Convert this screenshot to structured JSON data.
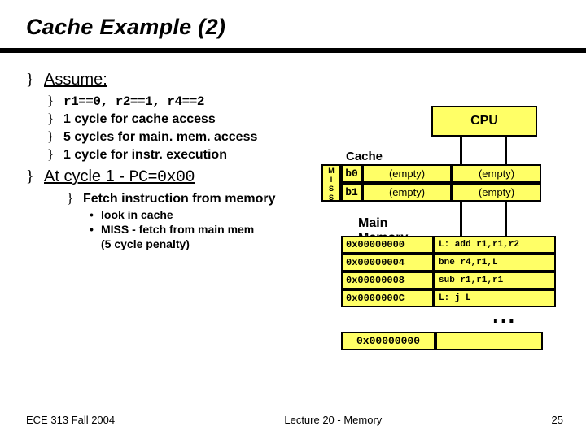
{
  "title": "Cache Example (2)",
  "assume": {
    "heading": "Assume:",
    "items": [
      "r1==0, r2==1, r4==2",
      "1 cycle for cache access",
      "5 cycles for main. mem. access",
      "1 cycle for instr. execution"
    ]
  },
  "cycle": {
    "heading_pre": "At cycle 1  - ",
    "pc": "PC=0x00",
    "fetch": "Fetch instruction from memory",
    "sub": [
      "look in cache",
      "MISS - fetch from main mem",
      "(5 cycle penalty)"
    ]
  },
  "diagram": {
    "cpu": "CPU",
    "cache_label": "Cache",
    "miss": "M\nI\nS\nS",
    "rows": [
      {
        "idx": "b0",
        "v1": "(empty)",
        "v2": "(empty)"
      },
      {
        "idx": "b1",
        "v1": "(empty)",
        "v2": "(empty)"
      }
    ],
    "mm_label": "Main Memory",
    "mm": [
      {
        "addr": "0x00000000",
        "ins": "L: add r1,r1,r2"
      },
      {
        "addr": "0x00000004",
        "ins": "   bne r4,r1,L"
      },
      {
        "addr": "0x00000008",
        "ins": "   sub r1,r1,r1"
      },
      {
        "addr": "0x0000000C",
        "ins": "L: j L"
      }
    ],
    "dots": "...",
    "pc_addr": "0x00000000"
  },
  "footer": {
    "left": "ECE 313 Fall 2004",
    "center": "Lecture 20 - Memory",
    "right": "25"
  }
}
